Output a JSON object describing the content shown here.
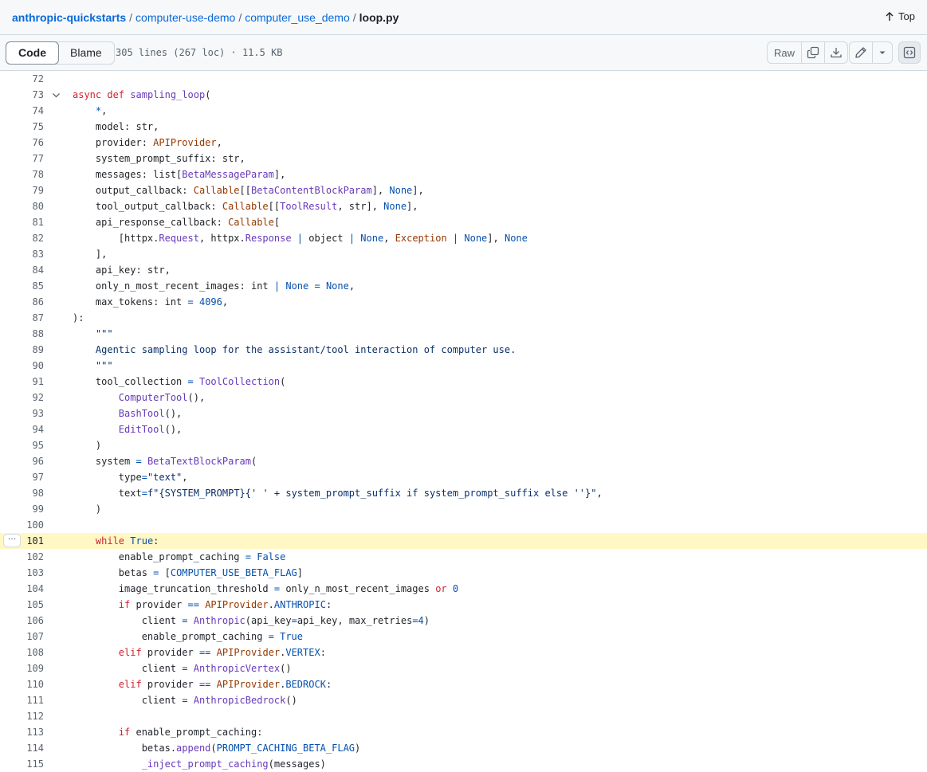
{
  "breadcrumb": {
    "repo": "anthropic-quickstarts",
    "dir1": "computer-use-demo",
    "dir2": "computer_use_demo",
    "file": "loop.py",
    "sep": "/"
  },
  "top_link": "Top",
  "toolbar": {
    "code_tab": "Code",
    "blame_tab": "Blame",
    "file_info": "305 lines (267 loc) · 11.5 KB",
    "raw_label": "Raw"
  },
  "code": {
    "highlighted_line": "101",
    "lines": [
      {
        "n": "72",
        "t": ""
      },
      {
        "n": "73",
        "t": "async def sampling_loop("
      },
      {
        "n": "74",
        "t": "    *,"
      },
      {
        "n": "75",
        "t": "    model: str,"
      },
      {
        "n": "76",
        "t": "    provider: APIProvider,"
      },
      {
        "n": "77",
        "t": "    system_prompt_suffix: str,"
      },
      {
        "n": "78",
        "t": "    messages: list[BetaMessageParam],"
      },
      {
        "n": "79",
        "t": "    output_callback: Callable[[BetaContentBlockParam], None],"
      },
      {
        "n": "80",
        "t": "    tool_output_callback: Callable[[ToolResult, str], None],"
      },
      {
        "n": "81",
        "t": "    api_response_callback: Callable["
      },
      {
        "n": "82",
        "t": "        [httpx.Request, httpx.Response | object | None, Exception | None], None"
      },
      {
        "n": "83",
        "t": "    ],"
      },
      {
        "n": "84",
        "t": "    api_key: str,"
      },
      {
        "n": "85",
        "t": "    only_n_most_recent_images: int | None = None,"
      },
      {
        "n": "86",
        "t": "    max_tokens: int = 4096,"
      },
      {
        "n": "87",
        "t": "):"
      },
      {
        "n": "88",
        "t": "    \"\"\""
      },
      {
        "n": "89",
        "t": "    Agentic sampling loop for the assistant/tool interaction of computer use."
      },
      {
        "n": "90",
        "t": "    \"\"\""
      },
      {
        "n": "91",
        "t": "    tool_collection = ToolCollection("
      },
      {
        "n": "92",
        "t": "        ComputerTool(),"
      },
      {
        "n": "93",
        "t": "        BashTool(),"
      },
      {
        "n": "94",
        "t": "        EditTool(),"
      },
      {
        "n": "95",
        "t": "    )"
      },
      {
        "n": "96",
        "t": "    system = BetaTextBlockParam("
      },
      {
        "n": "97",
        "t": "        type=\"text\","
      },
      {
        "n": "98",
        "t": "        text=f\"{SYSTEM_PROMPT}{' ' + system_prompt_suffix if system_prompt_suffix else ''}\","
      },
      {
        "n": "99",
        "t": "    )"
      },
      {
        "n": "100",
        "t": ""
      },
      {
        "n": "101",
        "t": "    while True:"
      },
      {
        "n": "102",
        "t": "        enable_prompt_caching = False"
      },
      {
        "n": "103",
        "t": "        betas = [COMPUTER_USE_BETA_FLAG]"
      },
      {
        "n": "104",
        "t": "        image_truncation_threshold = only_n_most_recent_images or 0"
      },
      {
        "n": "105",
        "t": "        if provider == APIProvider.ANTHROPIC:"
      },
      {
        "n": "106",
        "t": "            client = Anthropic(api_key=api_key, max_retries=4)"
      },
      {
        "n": "107",
        "t": "            enable_prompt_caching = True"
      },
      {
        "n": "108",
        "t": "        elif provider == APIProvider.VERTEX:"
      },
      {
        "n": "109",
        "t": "            client = AnthropicVertex()"
      },
      {
        "n": "110",
        "t": "        elif provider == APIProvider.BEDROCK:"
      },
      {
        "n": "111",
        "t": "            client = AnthropicBedrock()"
      },
      {
        "n": "112",
        "t": ""
      },
      {
        "n": "113",
        "t": "        if enable_prompt_caching:"
      },
      {
        "n": "114",
        "t": "            betas.append(PROMPT_CACHING_BETA_FLAG)"
      },
      {
        "n": "115",
        "t": "            _inject_prompt_caching(messages)"
      }
    ]
  }
}
